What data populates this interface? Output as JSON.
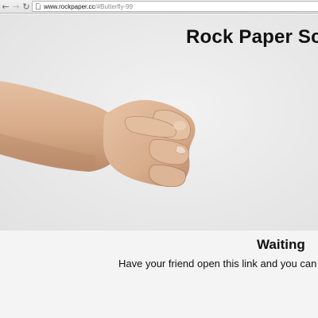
{
  "browser": {
    "url_host": "www.rockpaper.cc",
    "url_rest": "/#Butterfly-99",
    "back_icon": "back-arrow-icon",
    "forward_icon": "forward-arrow-icon",
    "reload_icon": "reload-icon"
  },
  "hero": {
    "title": "Rock Paper Sc",
    "image": "fist-rock-image"
  },
  "status": {
    "title": "Waiting",
    "message": "Have your friend open this link and you can play"
  }
}
